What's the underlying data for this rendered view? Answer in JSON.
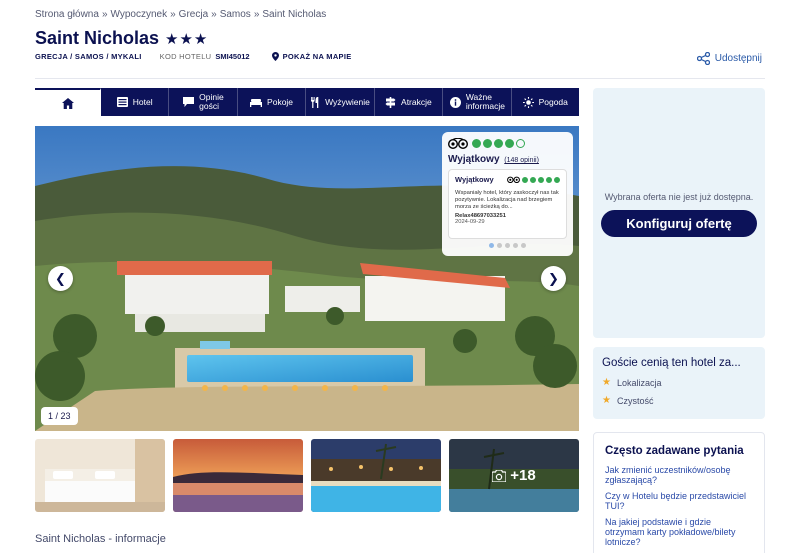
{
  "breadcrumb": [
    "Strona główna",
    "Wypoczynek",
    "Grecja",
    "Samos",
    "Saint Nicholas"
  ],
  "breadcrumb_sep": "»",
  "hotel": {
    "name": "Saint Nicholas",
    "stars": "★★★",
    "location": "GRECJA / SAMOS / MYKALI",
    "code_label": "KOD HOTELU",
    "code": "SMI45012",
    "map_label": "POKAŻ NA MAPIE"
  },
  "share_label": "Udostępnij",
  "tabs": [
    {
      "label": "",
      "icon": "home-icon"
    },
    {
      "label": "Hotel",
      "icon": "hotel-icon"
    },
    {
      "label": "Opinie gości",
      "icon": "chat-icon"
    },
    {
      "label": "Pokoje",
      "icon": "bed-icon"
    },
    {
      "label": "Wyżywienie",
      "icon": "cutlery-icon"
    },
    {
      "label": "Atrakcje",
      "icon": "signpost-icon"
    },
    {
      "label": "Ważne informacje",
      "icon": "info-icon"
    },
    {
      "label": "Pogoda",
      "icon": "sun-icon"
    }
  ],
  "gallery": {
    "counter": "1 / 23",
    "more_label": "+18"
  },
  "review": {
    "rating_label": "Wyjątkowy",
    "reviews_count": "(148 opinii)",
    "card_title": "Wyjątkowy",
    "text": "Wspaniały hotel, który zaskoczył nas tak pozytywnie. Lokalizacja nad brzegiem morza ze ścieżką do...",
    "author": "Relax48697033251",
    "date": "2024-09-29",
    "score": 4.5
  },
  "offer": {
    "message": "Wybrana oferta nie jest już dostępna.",
    "cta": "Konfiguruj ofertę"
  },
  "guests_value": {
    "heading": "Goście cenią ten hotel za...",
    "items": [
      "Lokalizacja",
      "Czystość"
    ]
  },
  "faq": {
    "heading": "Często zadawane pytania",
    "questions": [
      "Jak zmienić uczestników/osobę zgłaszającą?",
      "Czy w Hotelu będzie przedstawiciel TUI?",
      "Na jakiej podstawie i gdzie otrzymam karty pokładowe/bilety lotnicze?"
    ]
  },
  "info_title": "Saint Nicholas - informacje",
  "colors": {
    "navy": "#0c1259",
    "link": "#2a5aa8",
    "tripadvisor_green": "#34a853",
    "star": "#f0a92a"
  }
}
